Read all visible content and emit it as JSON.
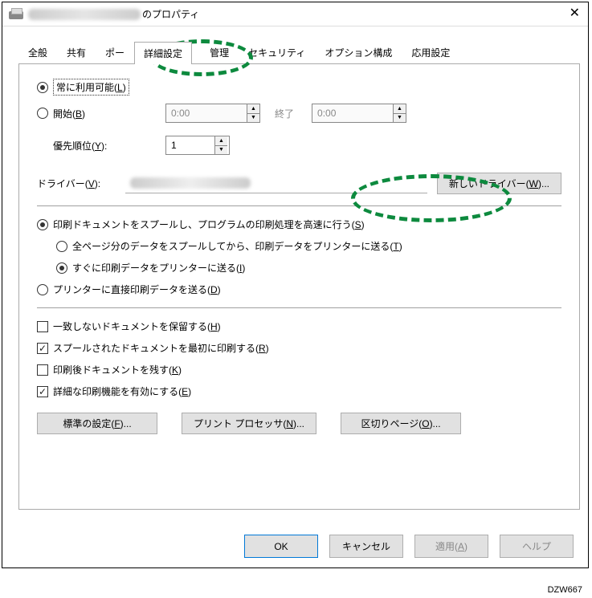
{
  "title": {
    "suffix": "のプロパティ"
  },
  "tabs": [
    "全般",
    "共有",
    "ポー",
    "詳細設定",
    "",
    "管理",
    "セキュリティ",
    "オプション構成",
    "応用設定"
  ],
  "active_tab": "詳細設定",
  "availability": {
    "always_label": "常に利用可能(",
    "always_shortcut": "L",
    "always_close": ")",
    "start_label": "開始(",
    "start_shortcut": "B",
    "start_close": ")",
    "start_time": "0:00",
    "end_label": "終了",
    "end_time": "0:00"
  },
  "priority": {
    "label_pre": "優先順位(",
    "shortcut": "Y",
    "label_post": "):",
    "value": "1"
  },
  "driver": {
    "label_pre": "ドライバー(",
    "shortcut": "V",
    "label_post": "):",
    "new_btn_pre": "新しいドライバー(",
    "new_btn_shortcut": "W",
    "new_btn_post": ")..."
  },
  "spool": {
    "spool_label_pre": "印刷ドキュメントをスプールし、プログラムの印刷処理を高速に行う(",
    "spool_shortcut": "S",
    "spool_close": ")",
    "allpages_pre": "全ページ分のデータをスプールしてから、印刷データをプリンターに送る(",
    "allpages_shortcut": "T",
    "allpages_close": ")",
    "immediate_pre": "すぐに印刷データをプリンターに送る(",
    "immediate_shortcut": "I",
    "immediate_close": ")",
    "direct_pre": "プリンターに直接印刷データを送る(",
    "direct_shortcut": "D",
    "direct_close": ")"
  },
  "checks": {
    "hold_pre": "一致しないドキュメントを保留する(",
    "hold_shortcut": "H",
    "hold_close": ")",
    "first_pre": "スプールされたドキュメントを最初に印刷する(",
    "first_shortcut": "R",
    "first_close": ")",
    "keep_pre": "印刷後ドキュメントを残す(",
    "keep_shortcut": "K",
    "keep_close": ")",
    "adv_pre": "詳細な印刷機能を有効にする(",
    "adv_shortcut": "E",
    "adv_close": ")"
  },
  "btns": {
    "defaults_pre": "標準の設定(",
    "defaults_shortcut": "F",
    "defaults_post": ")...",
    "proc_pre": "プリント プロセッサ(",
    "proc_shortcut": "N",
    "proc_post": ")...",
    "sep_pre": "区切りページ(",
    "sep_shortcut": "O",
    "sep_post": ")..."
  },
  "dialog_btns": {
    "ok": "OK",
    "cancel": "キャンセル",
    "apply_pre": "適用(",
    "apply_shortcut": "A",
    "apply_post": ")",
    "help": "ヘルプ"
  },
  "image_id": "DZW667"
}
